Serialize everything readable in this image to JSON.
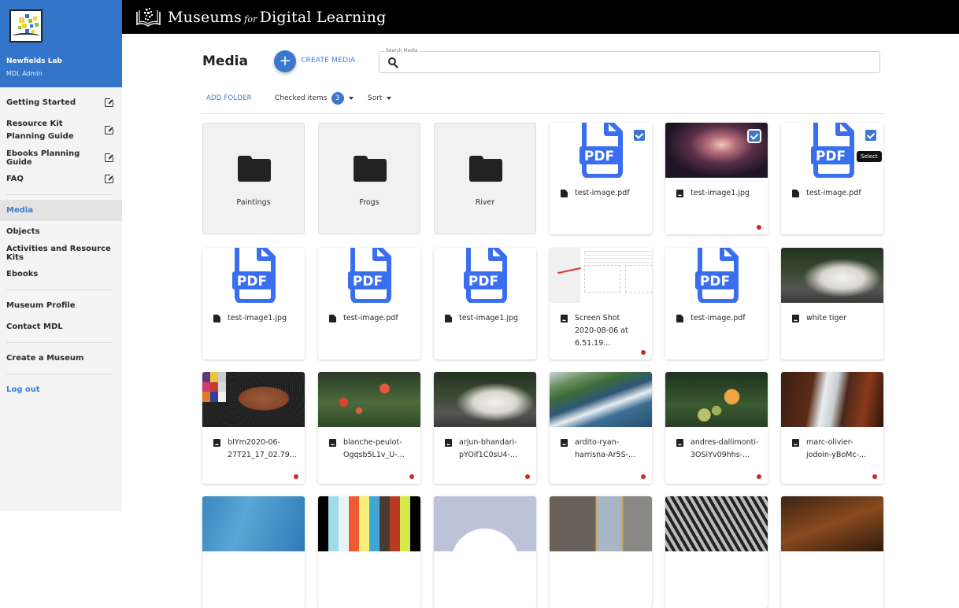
{
  "sidebar": {
    "org_name": "Newfields Lab",
    "role": "MDL Admin",
    "items": [
      {
        "label": "Getting Started",
        "external": true
      },
      {
        "label": "Resource Kit Planning Guide",
        "external": true
      },
      {
        "label": "Ebooks Planning Guide",
        "external": true
      },
      {
        "label": "FAQ",
        "external": true
      },
      {
        "label": "Media",
        "active": true
      },
      {
        "label": "Objects"
      },
      {
        "label": "Activities and Resource Kits"
      },
      {
        "label": "Ebooks"
      },
      {
        "label": "Museum Profile"
      },
      {
        "label": "Contact MDL"
      },
      {
        "label": "Create a Museum"
      },
      {
        "label": "Log out"
      }
    ]
  },
  "topbar": {
    "brand_main": "Museums",
    "brand_for": "for",
    "brand_end": "Digital Learning"
  },
  "main": {
    "title": "Media",
    "create_label": "CREATE MEDIA",
    "search": {
      "label": "Search Media",
      "value": "",
      "placeholder": ""
    },
    "toolbar": {
      "add_folder": "ADD FOLDER",
      "checked_label": "Checked items",
      "checked_count": "3",
      "sort_label": "Sort"
    },
    "tooltip": "Select",
    "folders": [
      "Paintings",
      "Frogs",
      "River"
    ],
    "items": [
      {
        "name": "test-image.pdf",
        "type": "pdf",
        "icon": "document-icon",
        "checked": true
      },
      {
        "name": "test-image1.jpg",
        "type": "image",
        "thumb": "nebula",
        "icon": "image-icon",
        "checked": true,
        "flag": true
      },
      {
        "name": "test-image.pdf",
        "type": "pdf",
        "icon": "document-icon",
        "checked": true
      },
      {
        "name": "test-image1.jpg",
        "type": "pdf",
        "icon": "document-icon"
      },
      {
        "name": "test-image.pdf",
        "type": "pdf",
        "icon": "document-icon"
      },
      {
        "name": "test-image1.jpg",
        "type": "pdf",
        "icon": "document-icon"
      },
      {
        "name": "Screen Shot 2020-08-06 at 6.51.19...",
        "type": "image",
        "thumb": "screenshot",
        "icon": "image-icon",
        "flag": true
      },
      {
        "name": "test-image.pdf",
        "type": "pdf",
        "icon": "document-icon"
      },
      {
        "name": "white tiger",
        "type": "image",
        "thumb": "tiger",
        "icon": "image-icon"
      },
      {
        "name": "bIYm2020-06-27T21_17_02.79...",
        "type": "image",
        "thumb": "stone",
        "icon": "image-icon",
        "flag": true
      },
      {
        "name": "blanche-peulot-Ogqsb5L1v_U-...",
        "type": "image",
        "thumb": "poppies",
        "icon": "image-icon",
        "flag": true
      },
      {
        "name": "arjun-bhandari-pYOif1C0sU4-...",
        "type": "image",
        "thumb": "tiger",
        "icon": "image-icon",
        "flag": true
      },
      {
        "name": "ardito-ryan-harrisna-Ar5S-...",
        "type": "image",
        "thumb": "coast",
        "icon": "image-icon",
        "flag": true
      },
      {
        "name": "andres-dallimonti-3OSiYv09hhs-...",
        "type": "image",
        "thumb": "oranges",
        "icon": "image-icon",
        "flag": true
      },
      {
        "name": "marc-olivier-jodoin-yBoMc-...",
        "type": "image",
        "thumb": "waterfall",
        "icon": "image-icon",
        "flag": true
      }
    ],
    "partial_row_thumbs": [
      "blue-lines",
      "color-bars",
      "cloud",
      "gallery",
      "zebra",
      "autumn"
    ]
  }
}
